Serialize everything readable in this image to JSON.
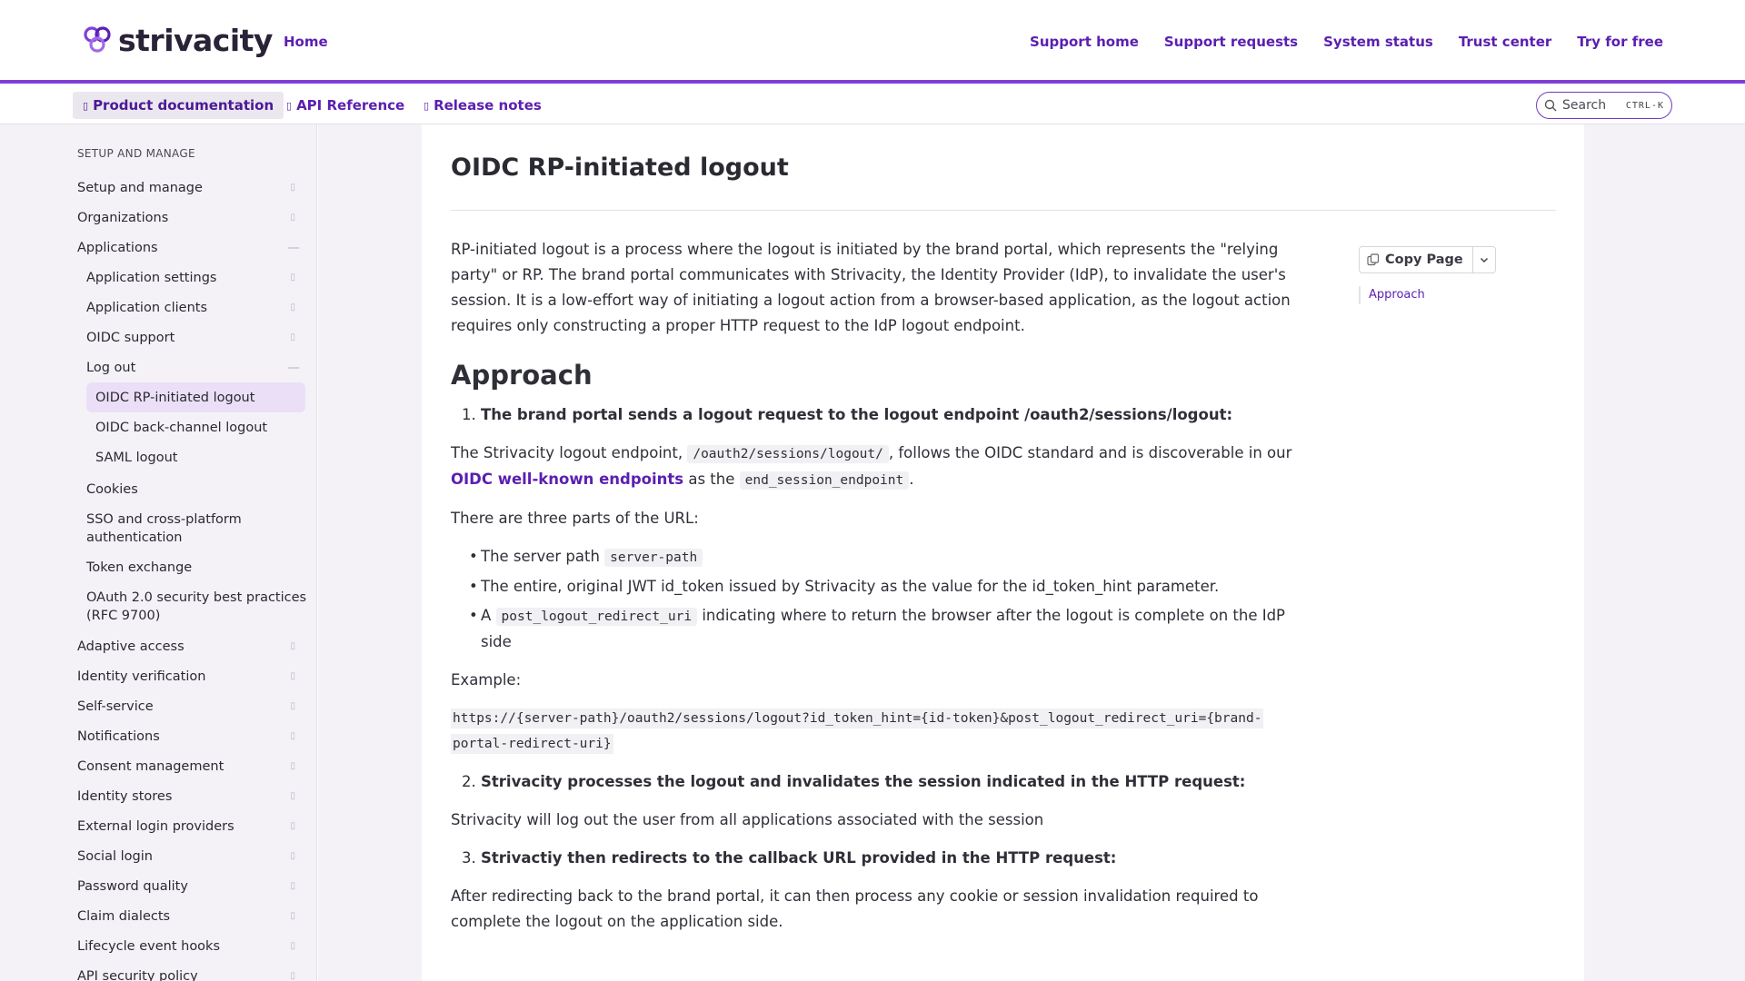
{
  "header": {
    "brand": "strivacity",
    "home": "Home",
    "links": [
      "Support home",
      "Support requests",
      "System status",
      "Trust center",
      "Try for free"
    ]
  },
  "subnav": {
    "tabs": [
      {
        "label": "Product documentation",
        "active": true
      },
      {
        "label": "API Reference",
        "active": false
      },
      {
        "label": "Release notes",
        "active": false
      }
    ],
    "search_placeholder": "Search",
    "search_shortcut": "CTRL-K"
  },
  "sidebar": {
    "heading": "SETUP AND MANAGE",
    "items": [
      {
        "label": "Setup and manage",
        "level": 0,
        "icon": "chevron-right"
      },
      {
        "label": "Organizations",
        "level": 0,
        "icon": "chevron-right"
      },
      {
        "label": "Applications",
        "level": 0,
        "icon": "collapse"
      },
      {
        "label": "Application settings",
        "level": 1,
        "icon": "chevron-right"
      },
      {
        "label": "Application clients",
        "level": 1,
        "icon": "chevron-right"
      },
      {
        "label": "OIDC support",
        "level": 1,
        "icon": "chevron-right"
      },
      {
        "label": "Log out",
        "level": 1,
        "icon": "collapse"
      },
      {
        "label": "OIDC RP-initiated logout",
        "level": 2,
        "active": true
      },
      {
        "label": "OIDC back-channel logout",
        "level": 2
      },
      {
        "label": "SAML logout",
        "level": 2
      },
      {
        "label": "Cookies",
        "level": 1
      },
      {
        "label": "SSO and cross-platform authentication",
        "level": 1
      },
      {
        "label": "Token exchange",
        "level": 1
      },
      {
        "label": "OAuth 2.0 security best practices (RFC 9700)",
        "level": 1
      },
      {
        "label": "Adaptive access",
        "level": 0,
        "icon": "chevron-right"
      },
      {
        "label": "Identity verification",
        "level": 0,
        "icon": "chevron-right"
      },
      {
        "label": "Self-service",
        "level": 0,
        "icon": "chevron-right"
      },
      {
        "label": "Notifications",
        "level": 0,
        "icon": "chevron-right"
      },
      {
        "label": "Consent management",
        "level": 0,
        "icon": "chevron-right"
      },
      {
        "label": "Identity stores",
        "level": 0,
        "icon": "chevron-right"
      },
      {
        "label": "External login providers",
        "level": 0,
        "icon": "chevron-right"
      },
      {
        "label": "Social login",
        "level": 0,
        "icon": "chevron-right"
      },
      {
        "label": "Password quality",
        "level": 0,
        "icon": "chevron-right"
      },
      {
        "label": "Claim dialects",
        "level": 0,
        "icon": "chevron-right"
      },
      {
        "label": "Lifecycle event hooks",
        "level": 0,
        "icon": "chevron-right"
      },
      {
        "label": "API security policy",
        "level": 0,
        "icon": "chevron-right"
      }
    ]
  },
  "article": {
    "title": "OIDC RP-initiated logout",
    "intro": "RP-initiated logout is a process where the logout is initiated by the brand portal, which represents the \"relying party\" or RP. The brand portal communicates with Strivacity, the Identity Provider (IdP), to invalidate the user's session. It is a low-effort way of initiating a logout action from a browser-based application, as the logout action requires only constructing a proper HTTP request to the IdP logout endpoint.",
    "approach_heading": "Approach",
    "step1": {
      "num": "1.",
      "text": "The brand portal sends a logout request to the logout endpoint /oauth2/sessions/logout:"
    },
    "step1_p_a": "The Strivacity logout endpoint,",
    "step1_code_a": "/oauth2/sessions/logout/",
    "step1_p_b": ", follows the OIDC standard and is discoverable in our",
    "step1_link": "OIDC well-known endpoints",
    "step1_p_c": "as the",
    "step1_code_b": "end_session_endpoint",
    "step1_p_d": ".",
    "url_parts_intro": "There are three parts of the URL:",
    "bullet1_text": "The server path",
    "bullet1_code": "server-path",
    "bullet2_text": "The entire, original JWT id_token issued by Strivacity as the value for the id_token_hint parameter.",
    "bullet3_pre": "A",
    "bullet3_code": "post_logout_redirect_uri",
    "bullet3_text": "indicating where to return the browser after the logout is complete on the IdP side",
    "example_label": "Example:",
    "example_code": "https://{server-path}/oauth2/sessions/logout?id_token_hint={id-token}&post_logout_redirect_uri={brand-portal-redirect-uri}",
    "step2": {
      "num": "2.",
      "text": "Strivacity processes the logout and invalidates the session indicated in the HTTP request:"
    },
    "step2_p": "Strivacity will log out the user from all applications associated with the session",
    "step3": {
      "num": "3.",
      "text": "Strivactiy then redirects to the callback URL provided in the HTTP request:"
    },
    "step3_p": "After redirecting back to the brand portal, it can then process any cookie or session invalidation required to complete the logout on the application side."
  },
  "right_rail": {
    "copy_label": "Copy Page",
    "toc": [
      "Approach"
    ]
  },
  "colors": {
    "accent": "#5b1fb0",
    "header_rule": "#7f3fd6",
    "sidebar_bg": "#f4f2f7",
    "active_item_bg": "#ebdff8"
  }
}
